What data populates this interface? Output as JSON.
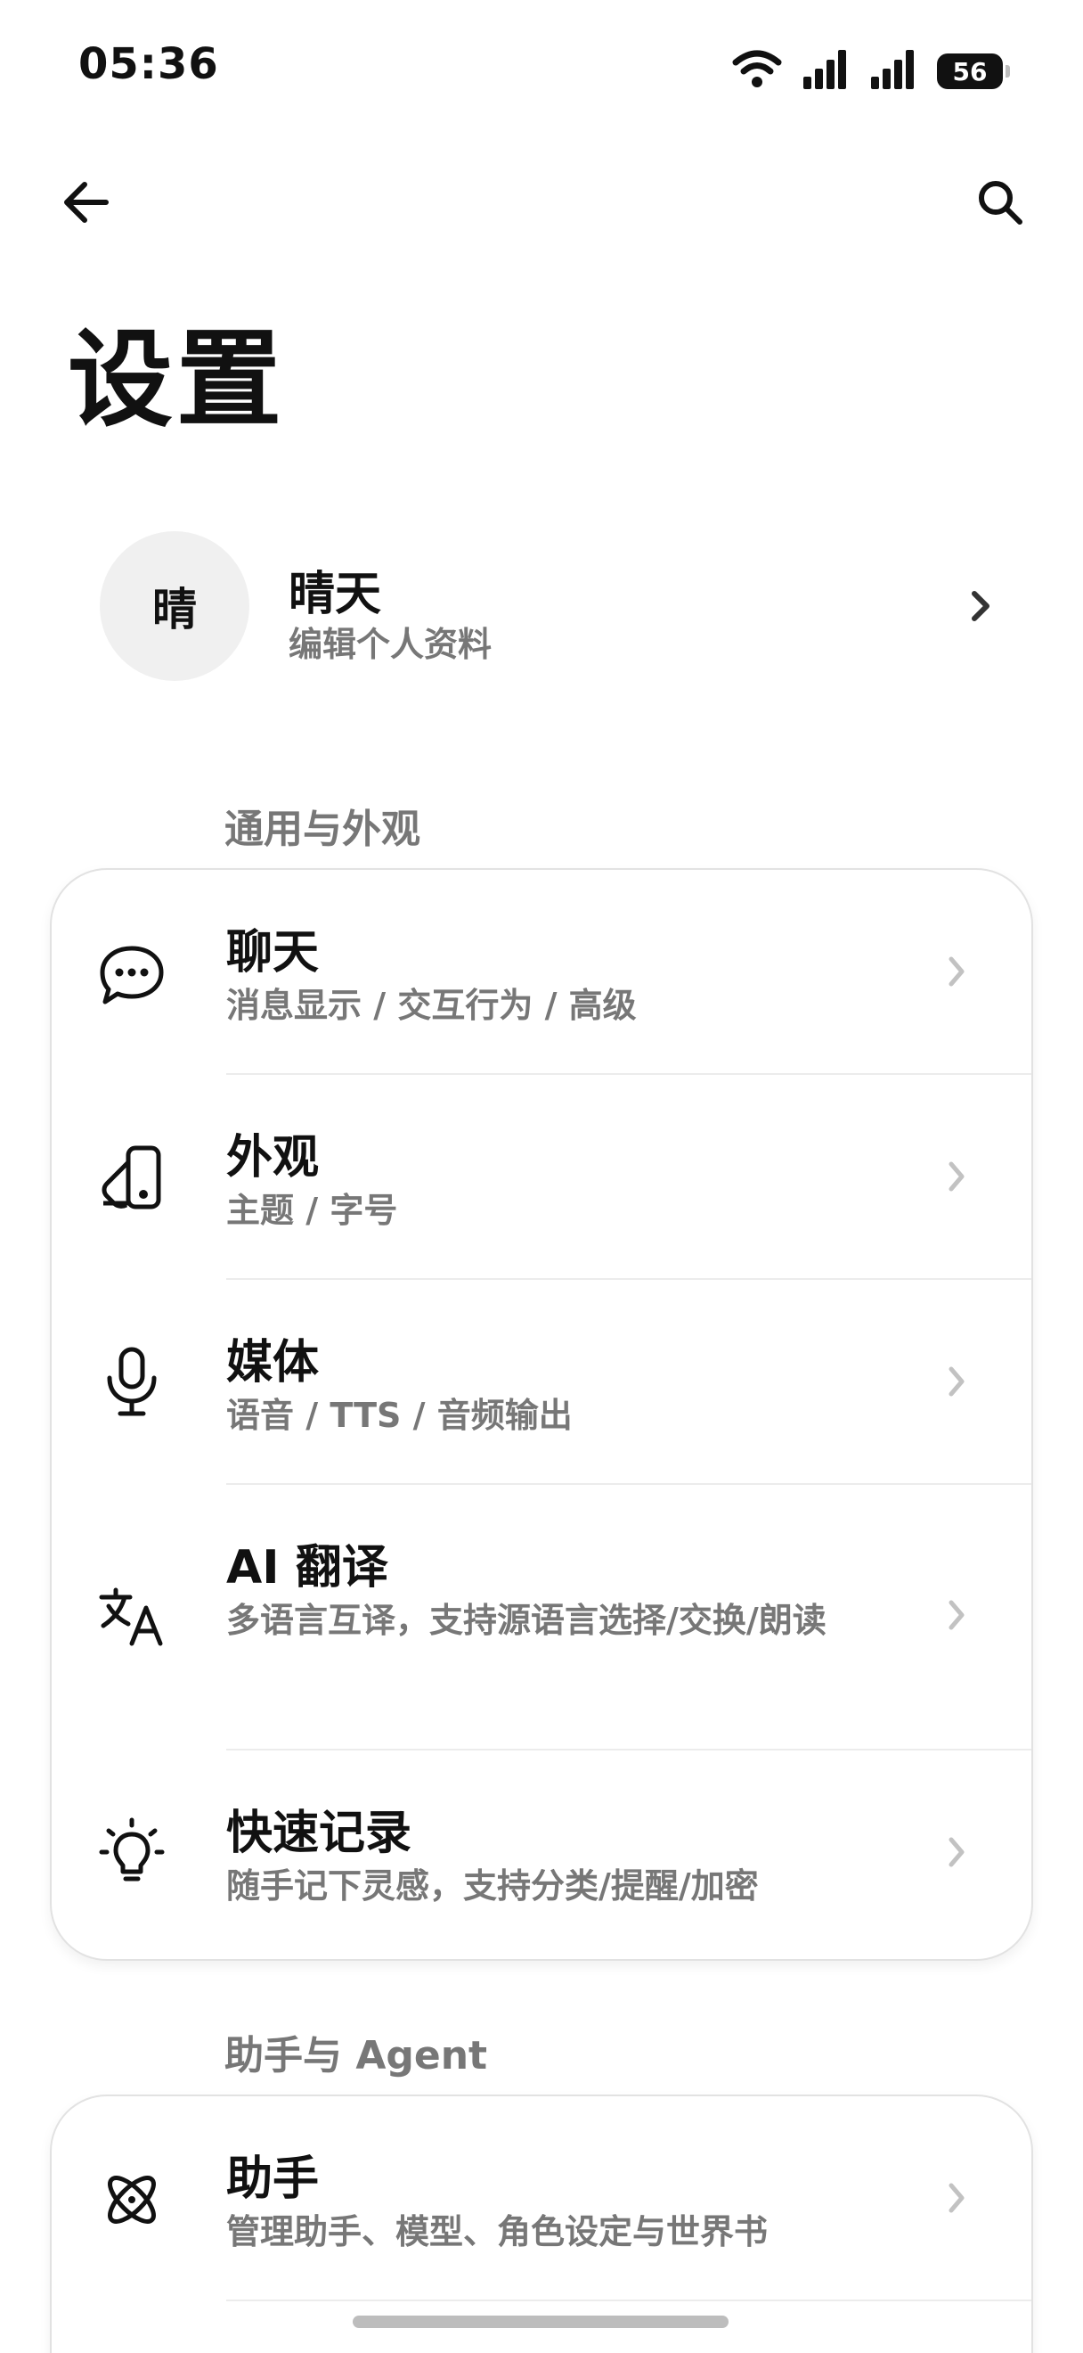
{
  "status_bar": {
    "time": "05:36",
    "battery": "56"
  },
  "header": {
    "title": "设置"
  },
  "profile": {
    "avatar_text": "晴",
    "name": "晴天",
    "subtitle": "编辑个人资料"
  },
  "sections": [
    {
      "label": "通用与外观",
      "items": [
        {
          "icon": "chat-bubble-icon",
          "title": "聊天",
          "subtitle": "消息显示 / 交互行为 / 高级"
        },
        {
          "icon": "appearance-icon",
          "title": "外观",
          "subtitle": "主题 / 字号"
        },
        {
          "icon": "microphone-icon",
          "title": "媒体",
          "subtitle": "语音 / TTS / 音频输出"
        },
        {
          "icon": "translate-icon",
          "title": "AI 翻译",
          "subtitle": "多语言互译，支持源语言选择/交换/朗读"
        },
        {
          "icon": "lightbulb-icon",
          "title": "快速记录",
          "subtitle": "随手记下灵感，支持分类/提醒/加密"
        }
      ]
    },
    {
      "label": "助手与 Agent",
      "items": [
        {
          "icon": "atom-icon",
          "title": "助手",
          "subtitle": "管理助手、模型、角色设定与世界书"
        }
      ]
    }
  ]
}
